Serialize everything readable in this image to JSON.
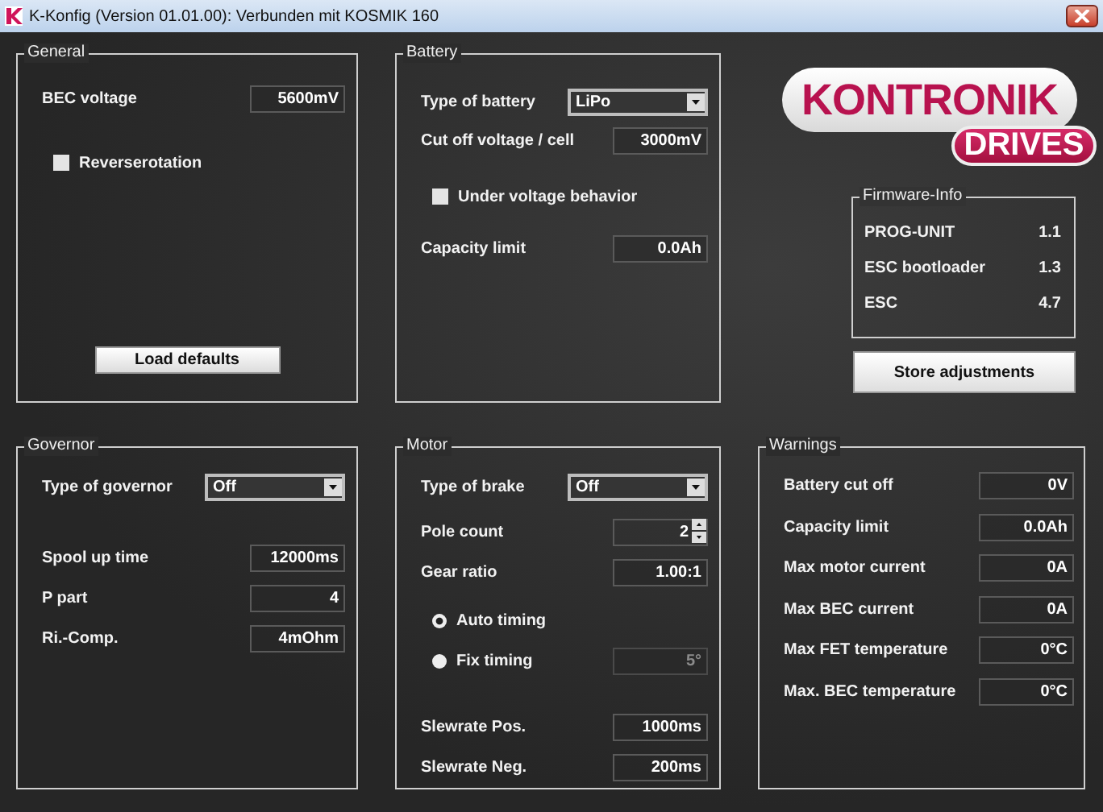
{
  "window": {
    "title": "K-Konfig (Version 01.01.00): Verbunden mit KOSMIK 160"
  },
  "general": {
    "title": "General",
    "items": [
      {
        "kind": "field",
        "label": "BEC voltage",
        "value": "5600mV"
      },
      {
        "kind": "checkbox",
        "label": "Reverserotation",
        "checked": false
      },
      {
        "kind": "button",
        "label": "Load defaults"
      }
    ]
  },
  "battery": {
    "title": "Battery",
    "items": [
      {
        "kind": "select",
        "label": "Type of battery",
        "value": "LiPo"
      },
      {
        "kind": "field",
        "label": "Cut off voltage / cell",
        "value": "3000mV"
      },
      {
        "kind": "checkbox",
        "label": "Under voltage behavior",
        "checked": false
      },
      {
        "kind": "field",
        "label": "Capacity limit",
        "value": "0.0Ah"
      }
    ]
  },
  "logo": {
    "line_1": "KONTRONIK",
    "line_2": "DRIVES"
  },
  "firmware": {
    "title": "Firmware-Info",
    "rows": [
      {
        "label": "PROG-UNIT",
        "value": "1.1"
      },
      {
        "label": "ESC bootloader",
        "value": "1.3"
      },
      {
        "label": "ESC",
        "value": "4.7"
      }
    ]
  },
  "store_button": "Store adjustments",
  "governor": {
    "title": "Governor",
    "items": [
      {
        "kind": "select",
        "label": "Type of governor",
        "value": "Off"
      },
      {
        "kind": "field",
        "label": "Spool up time",
        "value": "12000ms"
      },
      {
        "kind": "field",
        "label": "P part",
        "value": "4"
      },
      {
        "kind": "field",
        "label": "Ri.-Comp.",
        "value": "4mOhm"
      }
    ]
  },
  "motor": {
    "title": "Motor",
    "items": [
      {
        "kind": "select",
        "label": "Type of brake",
        "value": "Off"
      },
      {
        "kind": "spin",
        "label": "Pole count",
        "value": "2"
      },
      {
        "kind": "field",
        "label": "Gear ratio",
        "value": "1.00:1"
      },
      {
        "kind": "radio",
        "label": "Auto timing",
        "selected": true
      },
      {
        "kind": "radio",
        "label": "Fix timing",
        "selected": false,
        "value": "5°",
        "disabled": true
      },
      {
        "kind": "field",
        "label": "Slewrate Pos.",
        "value": "1000ms"
      },
      {
        "kind": "field",
        "label": "Slewrate Neg.",
        "value": "200ms"
      }
    ]
  },
  "warnings": {
    "title": "Warnings",
    "items": [
      {
        "kind": "field",
        "label": "Battery cut off",
        "value": "0V"
      },
      {
        "kind": "field",
        "label": "Capacity limit",
        "value": "0.0Ah"
      },
      {
        "kind": "field",
        "label": "Max motor current",
        "value": "0A"
      },
      {
        "kind": "field",
        "label": "Max BEC current",
        "value": "0A"
      },
      {
        "kind": "field",
        "label": "Max FET temperature",
        "value": "0°C"
      },
      {
        "kind": "field",
        "label": "Max. BEC temperature",
        "value": "0°C"
      }
    ]
  }
}
